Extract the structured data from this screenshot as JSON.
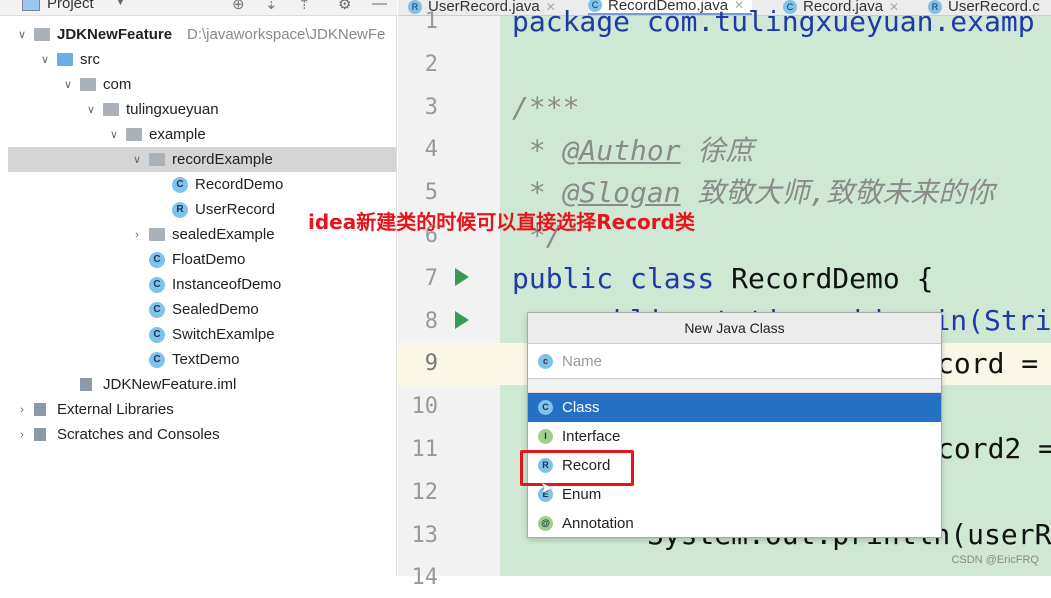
{
  "project_panel": {
    "title": "Project",
    "tree": [
      {
        "label": "JDKNewFeature",
        "path": "D:\\javaworkspace\\JDKNewFe",
        "level": 0,
        "icon": "module",
        "expanded": true
      },
      {
        "label": "src",
        "level": 1,
        "icon": "source-folder",
        "expanded": true
      },
      {
        "label": "com",
        "level": 2,
        "icon": "package",
        "expanded": true
      },
      {
        "label": "tulingxueyuan",
        "level": 3,
        "icon": "package",
        "expanded": true
      },
      {
        "label": "example",
        "level": 4,
        "icon": "package",
        "expanded": true
      },
      {
        "label": "recordExample",
        "level": 5,
        "icon": "package",
        "expanded": true,
        "selected": true
      },
      {
        "label": "RecordDemo",
        "level": 6,
        "icon": "class"
      },
      {
        "label": "UserRecord",
        "level": 6,
        "icon": "record"
      },
      {
        "label": "sealedExample",
        "level": 5,
        "icon": "package",
        "expanded": false
      },
      {
        "label": "FloatDemo",
        "level": 5,
        "icon": "class"
      },
      {
        "label": "InstanceofDemo",
        "level": 5,
        "icon": "class"
      },
      {
        "label": "SealedDemo",
        "level": 5,
        "icon": "class"
      },
      {
        "label": "SwitchExamlpe",
        "level": 5,
        "icon": "class"
      },
      {
        "label": "TextDemo",
        "level": 5,
        "icon": "class"
      },
      {
        "label": "JDKNewFeature.iml",
        "level": 2,
        "icon": "iml"
      },
      {
        "label": "External Libraries",
        "level": 0,
        "icon": "libraries",
        "expanded": false
      },
      {
        "label": "Scratches and Consoles",
        "level": 0,
        "icon": "scratches",
        "expanded": false
      }
    ]
  },
  "tabs": [
    {
      "label": "UserRecord.java",
      "icon": "R"
    },
    {
      "label": "RecordDemo.java",
      "icon": "C",
      "active": true
    },
    {
      "label": "Record.java",
      "icon": "C"
    },
    {
      "label": "UserRecord.c",
      "icon": "R"
    }
  ],
  "code": {
    "l1": "package com.tulingxueyuan.examp",
    "l3": "/***",
    "l4_star": " * ",
    "l4_tag": "@Author",
    "l4_text": " 徐庶",
    "l5_star": " * ",
    "l5_tag": "@Slogan",
    "l5_text": " 致敬大师,致敬未来的你",
    "l6": " */",
    "l7_kw": "public class",
    "l7_rest": " RecordDemo {",
    "l8": "    public static void main(Stri",
    "l9": "cord =",
    "l11": "cord2 =",
    "l13": "        System.out.println(userR"
  },
  "annotation": "idea新建类的时候可以直接选择Record类",
  "dialog": {
    "title": "New Java Class",
    "name_placeholder": "Name",
    "items": [
      {
        "label": "Class",
        "icon": "C",
        "color": "#7ec3ea",
        "selected": true
      },
      {
        "label": "Interface",
        "icon": "I",
        "color": "#9fd08a"
      },
      {
        "label": "Record",
        "icon": "R",
        "color": "#7ec3ea"
      },
      {
        "label": "Enum",
        "icon": "E",
        "color": "#7ec3ea"
      },
      {
        "label": "Annotation",
        "icon": "@",
        "color": "#9fd08a"
      }
    ]
  },
  "watermark": "CSDN @EricFRQ"
}
